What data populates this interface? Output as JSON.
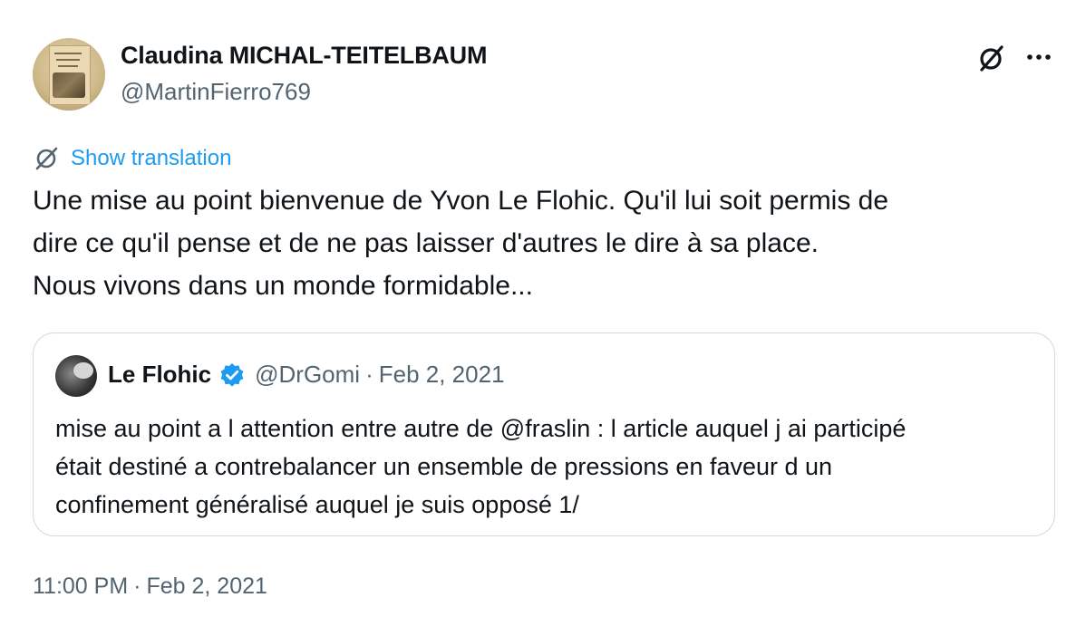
{
  "author": {
    "display_name": "Claudina MICHAL-TEITELBAUM",
    "handle": "@MartinFierro769"
  },
  "actions": {
    "grok_icon": "grok-icon",
    "more_icon": "more-icon"
  },
  "translation": {
    "label": "Show translation",
    "icon": "translate-icon"
  },
  "tweet_text": {
    "lines": [
      "Une mise au point bienvenue de Yvon Le Flohic. Qu'il lui soit permis de",
      "dire ce qu'il pense  et de ne pas laisser d'autres le dire à sa place.",
      "Nous vivons dans un monde formidable..."
    ]
  },
  "quoted_tweet": {
    "display_name": "Le Flohic",
    "verified": true,
    "handle": "@DrGomi",
    "separator": "·",
    "date": "Feb 2, 2021",
    "lines": [
      "mise au point a l attention entre autre de @fraslin : l article auquel j ai participé",
      "était destiné a contrebalancer un ensemble de pressions en faveur d un",
      "confinement généralisé auquel je suis opposé 1/"
    ]
  },
  "meta": {
    "time": "11:00 PM",
    "separator": "·",
    "date": "Feb 2, 2021"
  },
  "colors": {
    "link": "#1d9bf0",
    "text": "#0f1419",
    "secondary": "#536471",
    "border": "#cfd9de",
    "verified": "#1d9bf0"
  }
}
